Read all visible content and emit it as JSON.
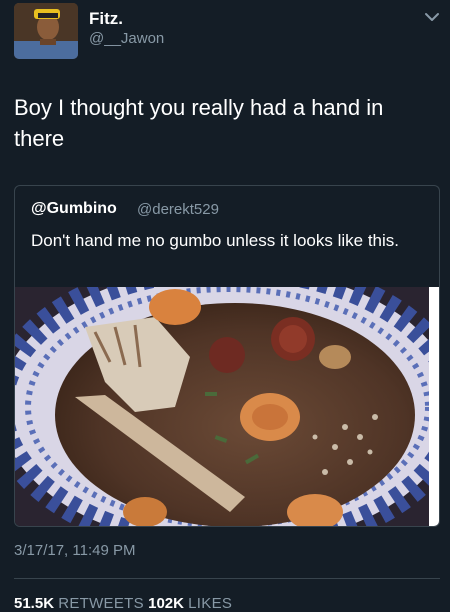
{
  "author": {
    "display_name": "Fitz.",
    "handle": "@__Jawon"
  },
  "tweet": {
    "text": "Boy I thought you really had a hand in there",
    "timestamp": "3/17/17, 11:49 PM"
  },
  "quoted_tweet": {
    "display_name": "@Gumbino",
    "handle": "@derekt529",
    "text": "Don't hand me no gumbo unless it looks like this."
  },
  "stats": {
    "retweets_count": "51.5K",
    "retweets_label": "RETWEETS",
    "likes_count": "102K",
    "likes_label": "LIKES"
  },
  "icons": {
    "caret": "chevron-down-icon"
  },
  "colors": {
    "background": "#141d26",
    "secondary_text": "#8899a6",
    "border": "#38444d"
  }
}
